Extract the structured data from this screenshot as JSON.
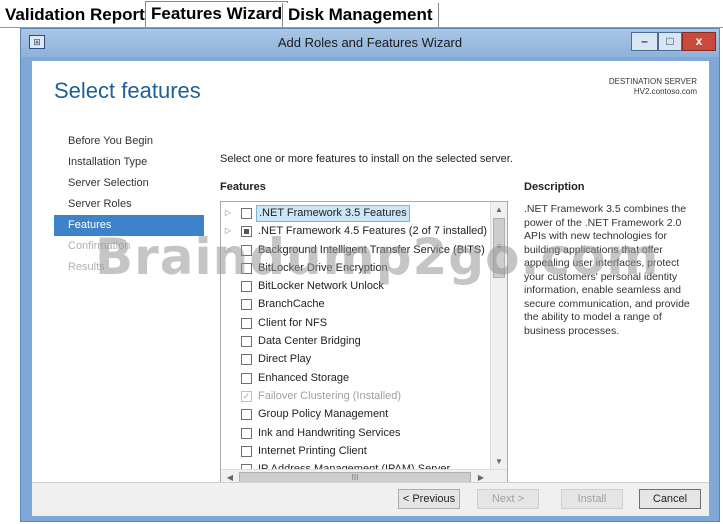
{
  "tabs": [
    {
      "label": "Validation Report"
    },
    {
      "label": "Features Wizard"
    },
    {
      "label": "Disk Management"
    }
  ],
  "window": {
    "title": "Add Roles and Features Wizard",
    "minimize_glyph": "–",
    "maximize_glyph": "□",
    "close_glyph": "x"
  },
  "page": {
    "heading": "Select features",
    "destination_label": "DESTINATION SERVER",
    "destination_value": "HV2.contoso.com",
    "intro": "Select one or more features to install on the selected server."
  },
  "nav": [
    {
      "label": "Before You Begin",
      "state": "normal"
    },
    {
      "label": "Installation Type",
      "state": "normal"
    },
    {
      "label": "Server Selection",
      "state": "normal"
    },
    {
      "label": "Server Roles",
      "state": "normal"
    },
    {
      "label": "Features",
      "state": "active"
    },
    {
      "label": "Confirmation",
      "state": "disabled"
    },
    {
      "label": "Results",
      "state": "disabled"
    }
  ],
  "features_label": "Features",
  "features": [
    {
      "label": ".NET Framework 3.5 Features",
      "expandable": true,
      "checked": "none",
      "selected": true
    },
    {
      "label": ".NET Framework 4.5 Features (2 of 7 installed)",
      "expandable": true,
      "checked": "partial"
    },
    {
      "label": "Background Intelligent Transfer Service (BITS)",
      "expandable": true,
      "checked": "none"
    },
    {
      "label": "BitLocker Drive Encryption",
      "expandable": false,
      "checked": "none"
    },
    {
      "label": "BitLocker Network Unlock",
      "expandable": false,
      "checked": "none"
    },
    {
      "label": "BranchCache",
      "expandable": false,
      "checked": "none"
    },
    {
      "label": "Client for NFS",
      "expandable": false,
      "checked": "none"
    },
    {
      "label": "Data Center Bridging",
      "expandable": false,
      "checked": "none"
    },
    {
      "label": "Direct Play",
      "expandable": false,
      "checked": "none"
    },
    {
      "label": "Enhanced Storage",
      "expandable": false,
      "checked": "none"
    },
    {
      "label": "Failover Clustering (Installed)",
      "expandable": false,
      "checked": "checked",
      "disabled": true
    },
    {
      "label": "Group Policy Management",
      "expandable": false,
      "checked": "none"
    },
    {
      "label": "Ink and Handwriting Services",
      "expandable": false,
      "checked": "none"
    },
    {
      "label": "Internet Printing Client",
      "expandable": false,
      "checked": "none"
    },
    {
      "label": "IP Address Management (IPAM) Server",
      "expandable": false,
      "checked": "none"
    }
  ],
  "description": {
    "label": "Description",
    "text": ".NET Framework 3.5 combines the power of the .NET Framework 2.0 APIs with new technologies for building applications that offer appealing user interfaces, protect your customers' personal identity information, enable seamless and secure communication, and provide the ability to model a range of business processes."
  },
  "buttons": {
    "previous": "< Previous",
    "next": "Next >",
    "install": "Install",
    "cancel": "Cancel"
  },
  "watermark": "Braindump2go.com",
  "icons": {
    "expand": "▷",
    "check": "✓",
    "scroll_up": "▲",
    "scroll_down": "▼",
    "scroll_left": "◀",
    "scroll_right": "▶",
    "grip_v": "≡",
    "grip_h": "III"
  },
  "colors": {
    "accent": "#3e83c9",
    "heading": "#1f5f99",
    "titlebar": "#8fb2da",
    "close": "#c94a3a"
  }
}
